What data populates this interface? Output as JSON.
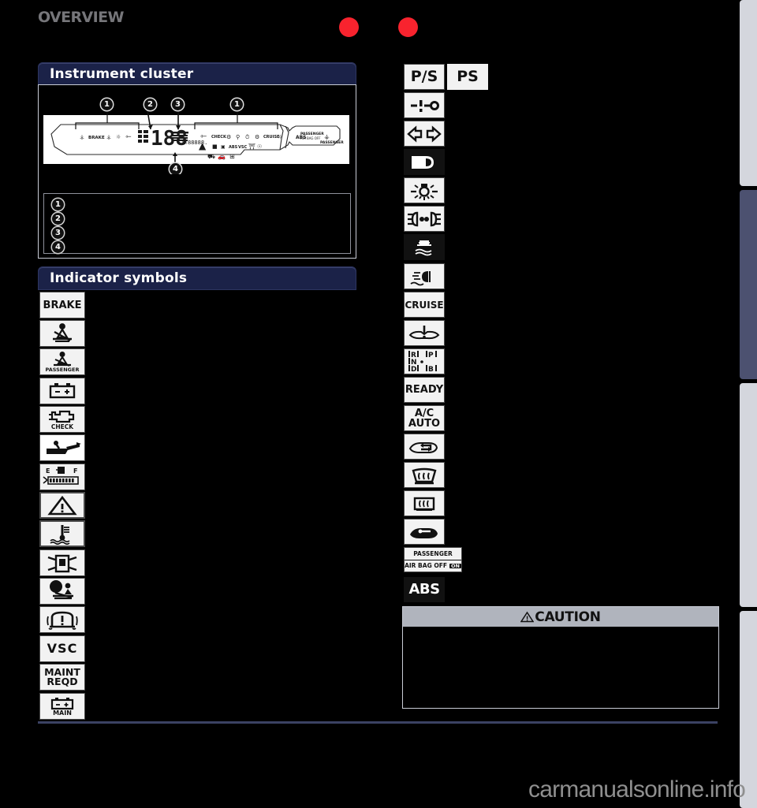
{
  "page": {
    "header_title": "OVERVIEW",
    "watermark": "carmanualsonline.info"
  },
  "markers": {
    "dot1": "red-marker-dot",
    "dot2": "red-marker-dot"
  },
  "sections": [
    {
      "id": "instrument-cluster",
      "title": "Instrument cluster"
    },
    {
      "id": "indicator-symbols",
      "title": "Indicator symbols"
    }
  ],
  "cluster": {
    "callouts": [
      "1",
      "2",
      "3",
      "1",
      "4"
    ],
    "legend": [
      {
        "num": "1",
        "text": ""
      },
      {
        "num": "2",
        "text": ""
      },
      {
        "num": "3",
        "text": ""
      },
      {
        "num": "4",
        "text": ""
      }
    ]
  },
  "indicator_symbols_left": [
    {
      "name": "brake-warning-indicator",
      "label": "BRAKE",
      "kind": "text"
    },
    {
      "name": "seat-belt-reminder-indicator",
      "label": "",
      "kind": "icon-seatbelt"
    },
    {
      "name": "passenger-seat-belt-reminder-indicator",
      "label": "PASSENGER",
      "kind": "icon-seatbelt-passenger"
    },
    {
      "name": "charging-system-indicator",
      "label": "",
      "kind": "icon-battery"
    },
    {
      "name": "malfunction-indicator-lamp",
      "label": "CHECK",
      "kind": "icon-engine"
    },
    {
      "name": "low-oil-pressure-indicator",
      "label": "",
      "kind": "icon-oil"
    },
    {
      "name": "low-fuel-level-indicator",
      "label": "E   F",
      "kind": "icon-fuel-gauge"
    },
    {
      "name": "master-warning-indicator",
      "label": "",
      "kind": "icon-triangle"
    },
    {
      "name": "high-engine-coolant-temperature-indicator",
      "label": "",
      "kind": "icon-coolant"
    },
    {
      "name": "open-door-indicator",
      "label": "",
      "kind": "icon-door-open"
    },
    {
      "name": "srs-airbag-indicator",
      "label": "",
      "kind": "icon-airbag"
    },
    {
      "name": "tire-pressure-warning-indicator",
      "label": "",
      "kind": "icon-tpms"
    },
    {
      "name": "vsc-indicator",
      "label": "VSC",
      "kind": "text"
    },
    {
      "name": "maintenance-required-indicator",
      "label": "MAINT\nREQD",
      "kind": "text"
    },
    {
      "name": "main-battery-indicator",
      "label": "MAIN",
      "kind": "icon-battery-main"
    }
  ],
  "indicator_symbols_right": [
    {
      "name": "power-steering-indicator",
      "label": "P/S",
      "kind": "text"
    },
    {
      "name": "ps-indicator",
      "label": "PS",
      "kind": "text"
    },
    {
      "name": "key-reminder-indicator",
      "label": "",
      "kind": "icon-key"
    },
    {
      "name": "turn-signal-indicator",
      "label": "",
      "kind": "icon-turn-signals"
    },
    {
      "name": "headlight-high-beam-indicator",
      "label": "",
      "kind": "icon-highbeam"
    },
    {
      "name": "tail-light-indicator",
      "label": "",
      "kind": "icon-taillight"
    },
    {
      "name": "headlight-indicator",
      "label": "",
      "kind": "icon-headlight"
    },
    {
      "name": "slip-indicator",
      "label": "",
      "kind": "icon-slip"
    },
    {
      "name": "fog-light-indicator",
      "label": "",
      "kind": "icon-foglight"
    },
    {
      "name": "cruise-control-indicator",
      "label": "CRUISE",
      "kind": "text"
    },
    {
      "name": "hood-open-indicator",
      "label": "",
      "kind": "icon-hood"
    },
    {
      "name": "shift-position-indicator",
      "label": "R P N D B",
      "kind": "icon-shift"
    },
    {
      "name": "ready-indicator",
      "label": "READY",
      "kind": "text"
    },
    {
      "name": "ac-auto-indicator",
      "label": "A/C\nAUTO",
      "kind": "text"
    },
    {
      "name": "air-recirculation-indicator",
      "label": "",
      "kind": "icon-recirc"
    },
    {
      "name": "rear-window-defogger-indicator",
      "label": "",
      "kind": "icon-windshield-defog"
    },
    {
      "name": "rear-defogger-indicator",
      "label": "",
      "kind": "icon-rear-defog"
    },
    {
      "name": "outside-air-indicator",
      "label": "",
      "kind": "icon-outside-air"
    },
    {
      "name": "passenger-airbag-off-indicator",
      "label": "PASSENGER",
      "label2": "AIR BAG OFF",
      "label3": "ON",
      "kind": "icon-passenger-airbag"
    },
    {
      "name": "abs-indicator",
      "label": "ABS",
      "kind": "text-dark"
    }
  ],
  "caution": {
    "title": "CAUTION",
    "body": ""
  },
  "colors": {
    "accent_red": "#f8232e",
    "title_bar": "#1b2248",
    "caution_head": "#b0b4bd",
    "edge_tab_light": "#d4d6dd",
    "edge_tab_dark": "#4c5170",
    "rule": "#3b4263"
  },
  "edge_tabs": [
    {
      "name": "edge-tab-1",
      "style": "light"
    },
    {
      "name": "edge-tab-2",
      "style": "dark"
    },
    {
      "name": "edge-tab-3",
      "style": "light"
    },
    {
      "name": "edge-tab-4",
      "style": "light"
    }
  ]
}
